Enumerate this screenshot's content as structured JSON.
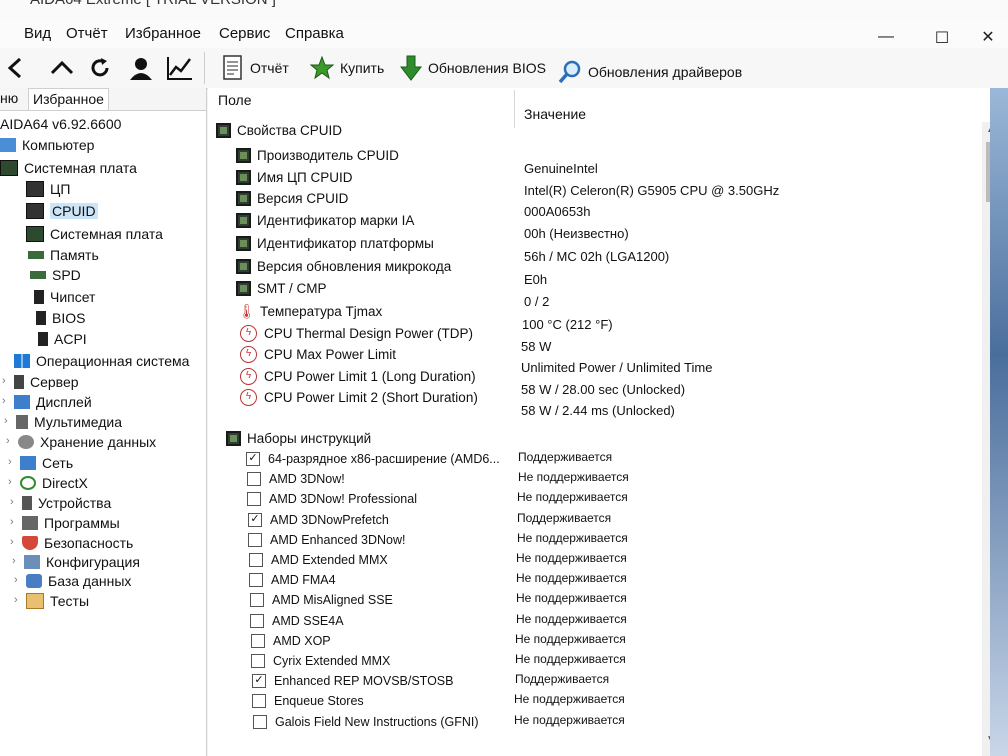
{
  "window": {
    "title": "AIDA64 Extreme  [ TRIAL VERSION ]"
  },
  "menu": [
    "Вид",
    "Отчёт",
    "Избранное",
    "Сервис",
    "Справка"
  ],
  "toolbar": {
    "report": "Отчёт",
    "buy": "Купить",
    "bios_updates": "Обновления BIOS",
    "driver_updates": "Обновления драйверов"
  },
  "left_panel": {
    "tab_menu": "ню",
    "tab_favorites": "Избранное",
    "version": "AIDA64 v6.92.6600",
    "tree": [
      "Компьютер",
      "Системная плата",
      "ЦП",
      "CPUID",
      "Системная плата",
      "Память",
      "SPD",
      "Чипсет",
      "BIOS",
      "ACPI",
      "Операционная система",
      "Сервер",
      "Дисплей",
      "Мультимедиа",
      "Хранение данных",
      "Сеть",
      "DirectX",
      "Устройства",
      "Программы",
      "Безопасность",
      "Конфигурация",
      "База данных",
      "Тесты"
    ]
  },
  "main": {
    "col_field": "Поле",
    "col_value": "Значение",
    "group_cpuid": "Свойства CPUID",
    "props": [
      {
        "name": "Производитель CPUID",
        "value": "GenuineIntel",
        "icon": "chip"
      },
      {
        "name": "Имя ЦП CPUID",
        "value": "Intel(R) Celeron(R) G5905 CPU @ 3.50GHz",
        "icon": "chip"
      },
      {
        "name": "Версия CPUID",
        "value": "000A0653h",
        "icon": "chip"
      },
      {
        "name": "Идентификатор марки IA",
        "value": "00h  (Неизвестно)",
        "icon": "chip"
      },
      {
        "name": "Идентификатор платформы",
        "value": "56h / MC 02h  (LGA1200)",
        "icon": "chip"
      },
      {
        "name": "Версия обновления микрокода",
        "value": "E0h",
        "icon": "chip"
      },
      {
        "name": "SMT / CMP",
        "value": "0 / 2",
        "icon": "chip"
      },
      {
        "name": "Температура Tjmax",
        "value": "100 °C  (212 °F)",
        "icon": "thermometer"
      },
      {
        "name": "CPU Thermal Design Power (TDP)",
        "value": "58 W",
        "icon": "power"
      },
      {
        "name": "CPU Max Power Limit",
        "value": "Unlimited Power / Unlimited Time",
        "icon": "power"
      },
      {
        "name": "CPU Power Limit 1 (Long Duration)",
        "value": "58 W / 28.00 sec  (Unlocked)",
        "icon": "power"
      },
      {
        "name": "CPU Power Limit 2 (Short Duration)",
        "value": "58 W / 2.44 ms  (Unlocked)",
        "icon": "power"
      }
    ],
    "group_isa": "Наборы инструкций",
    "isa": [
      {
        "name": "64-разрядное x86-расширение (AMD6...",
        "value": "Поддерживается",
        "checked": true
      },
      {
        "name": "AMD 3DNow!",
        "value": "Не поддерживается",
        "checked": false
      },
      {
        "name": "AMD 3DNow! Professional",
        "value": "Не поддерживается",
        "checked": false
      },
      {
        "name": "AMD 3DNowPrefetch",
        "value": "Поддерживается",
        "checked": true
      },
      {
        "name": "AMD Enhanced 3DNow!",
        "value": "Не поддерживается",
        "checked": false
      },
      {
        "name": "AMD Extended MMX",
        "value": "Не поддерживается",
        "checked": false
      },
      {
        "name": "AMD FMA4",
        "value": "Не поддерживается",
        "checked": false
      },
      {
        "name": "AMD MisAligned SSE",
        "value": "Не поддерживается",
        "checked": false
      },
      {
        "name": "AMD SSE4A",
        "value": "Не поддерживается",
        "checked": false
      },
      {
        "name": "AMD XOP",
        "value": "Не поддерживается",
        "checked": false
      },
      {
        "name": "Cyrix Extended MMX",
        "value": "Не поддерживается",
        "checked": false
      },
      {
        "name": "Enhanced REP MOVSB/STOSB",
        "value": "Поддерживается",
        "checked": true
      },
      {
        "name": "Enqueue Stores",
        "value": "Не поддерживается",
        "checked": false
      },
      {
        "name": "Galois Field New Instructions (GFNI)",
        "value": "Не поддерживается",
        "checked": false
      }
    ]
  }
}
